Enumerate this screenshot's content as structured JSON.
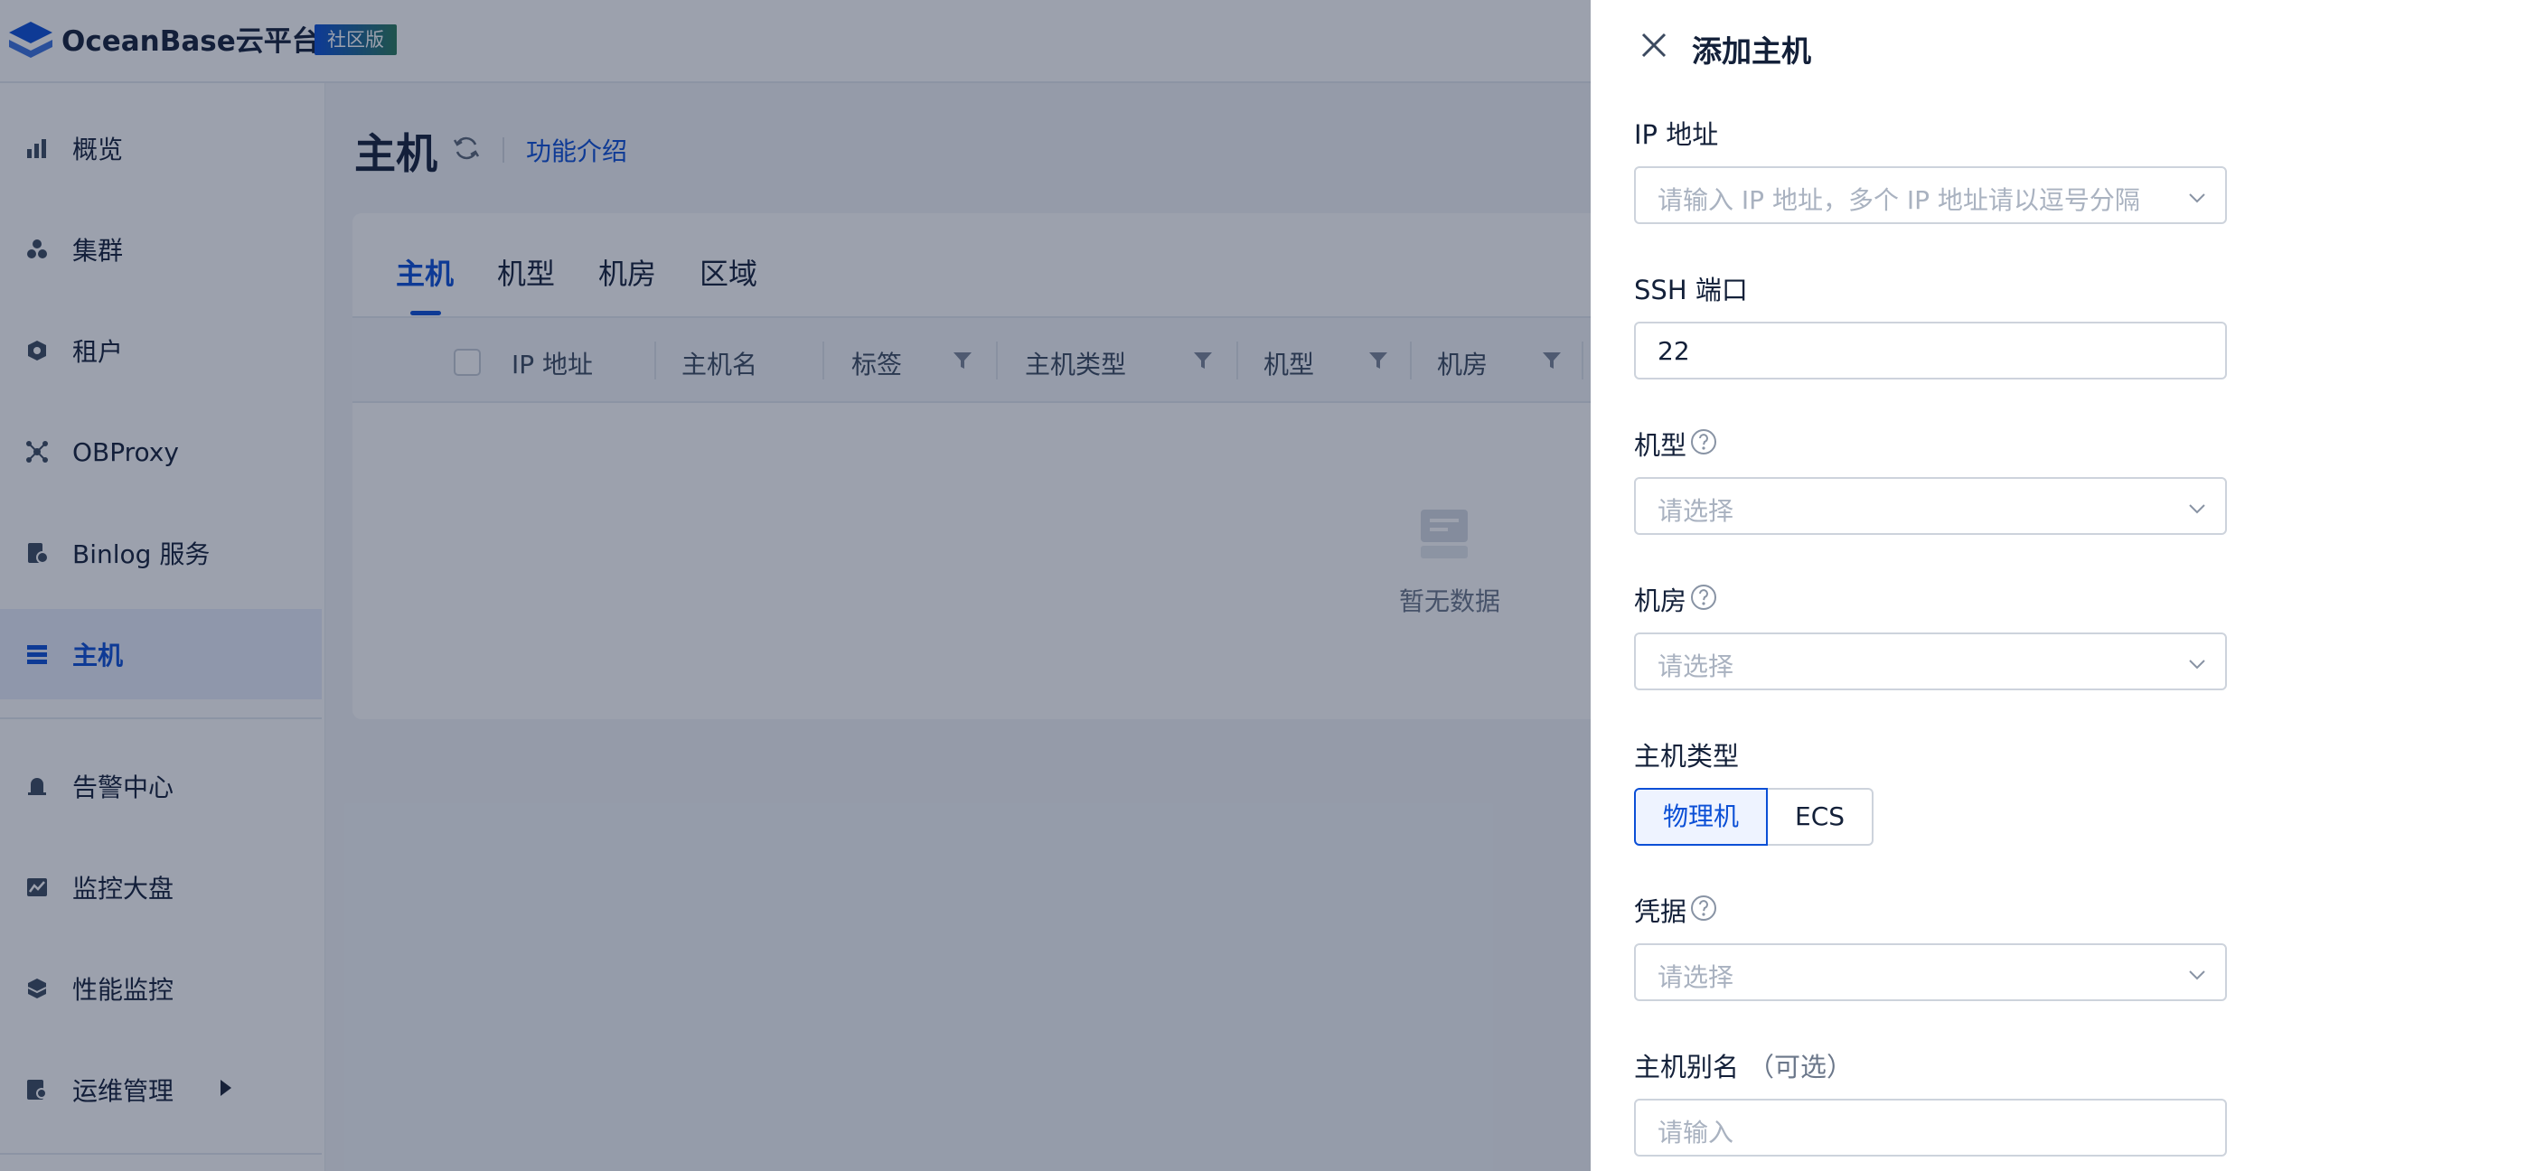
{
  "app": {
    "brand": "OceanBase云平台",
    "edition_badge": "社区版"
  },
  "sidebar": {
    "items": [
      {
        "label": "概览",
        "icon": "bar-chart-icon"
      },
      {
        "label": "集群",
        "icon": "cluster-icon"
      },
      {
        "label": "租户",
        "icon": "tenant-icon"
      },
      {
        "label": "OBProxy",
        "icon": "proxy-icon"
      },
      {
        "label": "Binlog 服务",
        "icon": "binlog-icon"
      },
      {
        "label": "主机",
        "icon": "host-icon",
        "active": true
      },
      {
        "label": "告警中心",
        "icon": "alarm-icon"
      },
      {
        "label": "监控大盘",
        "icon": "monitor-dashboard-icon"
      },
      {
        "label": "性能监控",
        "icon": "performance-icon"
      },
      {
        "label": "运维管理",
        "icon": "ops-icon"
      }
    ]
  },
  "main": {
    "title": "主机",
    "feature_link": "功能介绍",
    "tabs": [
      "主机",
      "机型",
      "机房",
      "区域"
    ],
    "active_tab": 0,
    "columns": [
      "IP 地址",
      "主机名",
      "标签",
      "主机类型",
      "机型",
      "机房"
    ],
    "empty_text": "暂无数据"
  },
  "drawer": {
    "title": "添加主机",
    "ip": {
      "label": "IP 地址",
      "placeholder": "请输入 IP 地址，多个 IP 地址请以逗号分隔"
    },
    "ssh_port": {
      "label": "SSH 端口",
      "value": "22"
    },
    "machine_type": {
      "label": "机型",
      "placeholder": "请选择"
    },
    "idc": {
      "label": "机房",
      "placeholder": "请选择"
    },
    "host_type": {
      "label": "主机类型",
      "options": [
        "物理机",
        "ECS"
      ],
      "selected": "物理机"
    },
    "credential": {
      "label": "凭据",
      "placeholder": "请选择"
    },
    "alias": {
      "label": "主机别名",
      "optional": "（可选）",
      "placeholder": "请输入"
    }
  },
  "colors": {
    "primary": "#0b4fd6",
    "mask": "rgba(20,32,60,0.42)"
  }
}
